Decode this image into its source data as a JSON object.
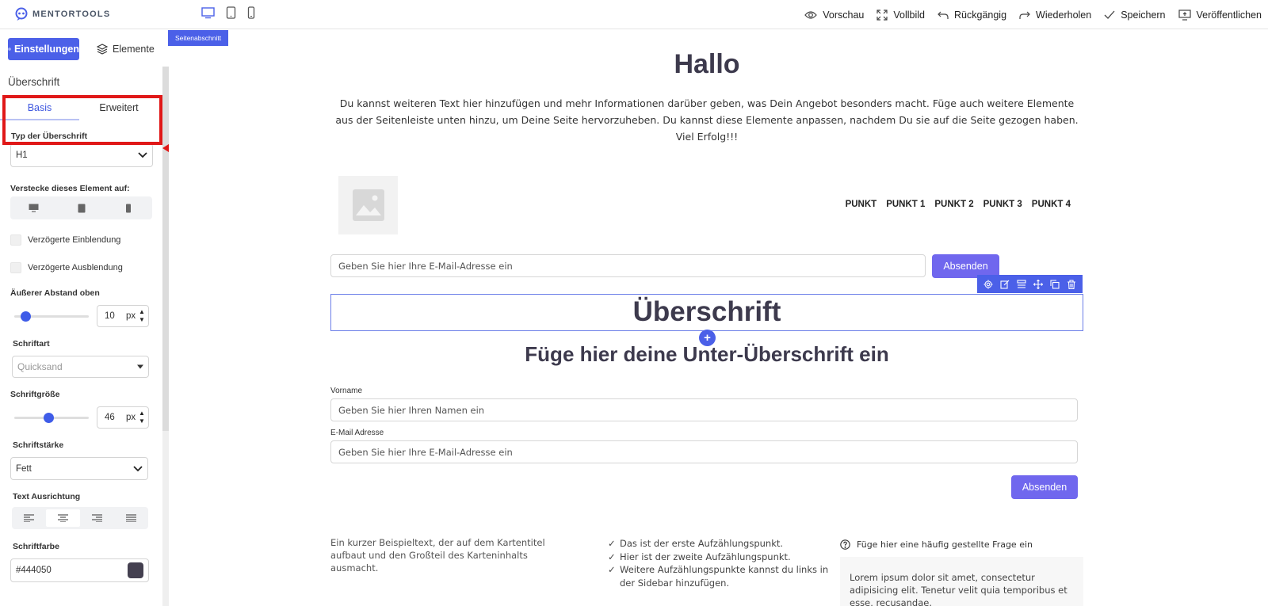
{
  "app": {
    "logo_text": "MENTORTOOLS",
    "accent_color": "#4b60e8",
    "button_color": "#7067ee",
    "annotation_color": "#e01818"
  },
  "topbar": {
    "devices": [
      "desktop-icon",
      "tablet-icon",
      "mobile-icon"
    ],
    "actions": [
      {
        "label": "Vorschau",
        "icon": "eye-icon"
      },
      {
        "label": "Vollbild",
        "icon": "fullscreen-icon"
      },
      {
        "label": "Rückgängig",
        "icon": "undo-icon"
      },
      {
        "label": "Wiederholen",
        "icon": "redo-icon"
      },
      {
        "label": "Speichern",
        "icon": "check-icon"
      },
      {
        "label": "Veröffentlichen",
        "icon": "publish-icon"
      }
    ]
  },
  "sidebar": {
    "tab_settings": "Einstellungen",
    "tab_elements": "Elemente",
    "element_title": "Überschrift",
    "subtab_basic": "Basis",
    "subtab_advanced": "Erweitert",
    "heading_type": {
      "label": "Typ der Überschrift",
      "value": "H1"
    },
    "hide_on": {
      "label": "Verstecke dieses Element auf:"
    },
    "delayed_show": "Verzögerte Einblendung",
    "delayed_hide": "Verzögerte Ausblendung",
    "margin_top": {
      "label": "Äußerer Abstand oben",
      "value": "10",
      "unit": "px",
      "fraction": 0.1
    },
    "font": {
      "label": "Schriftart",
      "placeholder": "Quicksand"
    },
    "font_size": {
      "label": "Schriftgröße",
      "value": "46",
      "unit": "px",
      "fraction": 0.46
    },
    "font_weight": {
      "label": "Schriftstärke",
      "value": "Fett"
    },
    "text_align": {
      "label": "Text Ausrichtung",
      "selected": "center"
    },
    "font_color": {
      "label": "Schriftfarbe",
      "value": "#444050"
    }
  },
  "canvas": {
    "section_tag": "Seitenabschnitt",
    "title": "Hallo",
    "intro": "Du kannst weiteren Text hier hinzufügen und mehr Informationen darüber geben, was Dein Angebot besonders macht. Füge auch weitere Elemente aus der Seitenleiste unten hinzu, um Deine Seite hervorzuheben. Du kannst diese Elemente anpassen, nachdem Du sie auf die Seite gezogen haben. Viel Erfolg!!!",
    "nav": [
      "PUNKT",
      "PUNKT 1",
      "PUNKT 2",
      "PUNKT 3",
      "PUNKT 4"
    ],
    "email_optin": {
      "placeholder": "Geben Sie hier Ihre E-Mail-Adresse ein",
      "button": "Absenden"
    },
    "heading": "Überschrift",
    "subheading": "Füge hier deine Unter-Überschrift ein",
    "form": {
      "name_label": "Vorname",
      "name_placeholder": "Geben Sie hier Ihren Namen ein",
      "email_label": "E-Mail Adresse",
      "email_placeholder": "Geben Sie hier Ihre E-Mail-Adresse ein",
      "submit": "Absenden"
    },
    "card_text": "Ein kurzer Beispieltext, der auf dem Kartentitel aufbaut und den Großteil des Karteninhalts ausmacht.",
    "checklist": [
      "Das ist der erste Aufzählungspunkt.",
      "Hier ist der zweite Aufzählungspunkt.",
      "Weitere Aufzählungspunkte kannst du links in der Sidebar hinzufügen."
    ],
    "faq": {
      "question": "Füge hier eine häufig gestellte Frage ein",
      "answer": "Lorem ipsum dolor sit amet, consectetur adipisicing elit. Tenetur velit quia temporibus et esse, recusandae."
    }
  }
}
